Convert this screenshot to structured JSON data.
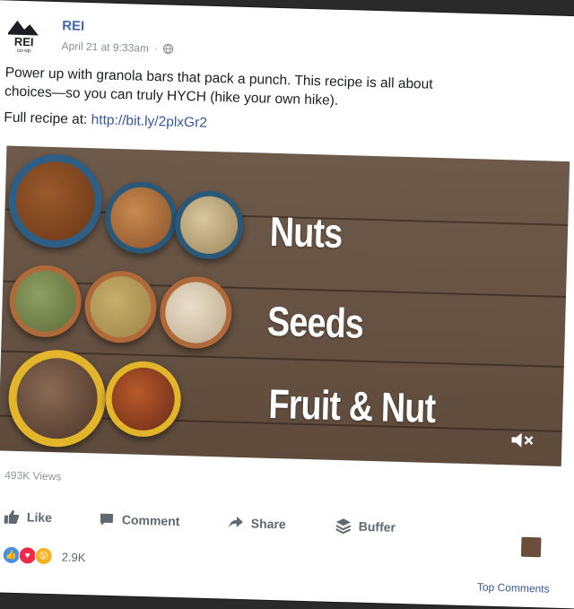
{
  "post": {
    "page_name": "REI",
    "logo_text": "REI",
    "logo_subtext": "co-op",
    "timestamp": "April 21 at 9:33am",
    "text_line1": "Power up with granola bars that pack a punch. This recipe is all about",
    "text_line2": "choices—so you can truly HYCH (hike your own hike).",
    "recipe_prefix": "Full recipe at: ",
    "recipe_link": "http://bit.ly/2plxGr2"
  },
  "media": {
    "labels": [
      "Nuts",
      "Seeds",
      "Fruit & Nut"
    ]
  },
  "stats": {
    "views": "493K Views",
    "reaction_count": "2.9K"
  },
  "actions": [
    {
      "label": "Like",
      "icon": "thumbs-up-icon"
    },
    {
      "label": "Comment",
      "icon": "comment-icon"
    },
    {
      "label": "Share",
      "icon": "share-icon"
    },
    {
      "label": "Buffer",
      "icon": "buffer-icon"
    }
  ],
  "footer": {
    "top_comments": "Top Comments"
  },
  "colors": {
    "link": "#385898",
    "page_name": "#4267b2",
    "wood": "#6e5a4a",
    "like_blue": "#4a90e2",
    "love_red": "#f0284a",
    "wow_yellow": "#f7b125"
  }
}
